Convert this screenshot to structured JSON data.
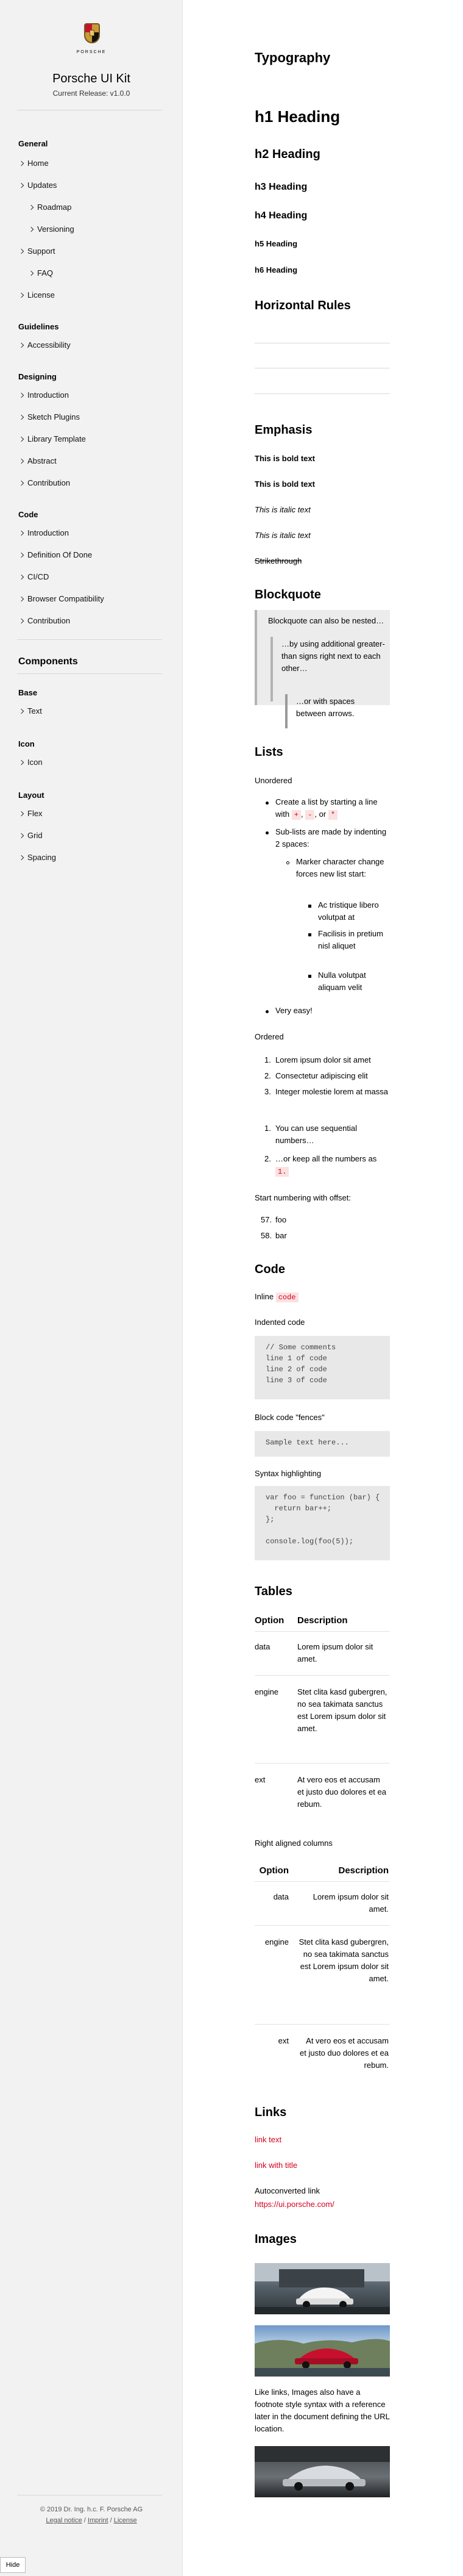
{
  "sidebar": {
    "brand": "PORSCHE",
    "title": "Porsche UI Kit",
    "release": "Current Release: v1.0.0",
    "general": {
      "label": "General",
      "items": [
        "Home",
        "Updates",
        "Roadmap",
        "Versioning",
        "Support",
        "FAQ",
        "License"
      ]
    },
    "guidelines": {
      "label": "Guidelines",
      "items": [
        "Accessibility"
      ]
    },
    "designing": {
      "label": "Designing",
      "items": [
        "Introduction",
        "Sketch Plugins",
        "Library Template",
        "Abstract",
        "Contribution"
      ]
    },
    "code": {
      "label": "Code",
      "items": [
        "Introduction",
        "Definition Of Done",
        "CI/CD",
        "Browser Compatibility",
        "Contribution"
      ]
    },
    "components_title": "Components",
    "base": {
      "label": "Base",
      "items": [
        "Text"
      ]
    },
    "icon": {
      "label": "Icon",
      "items": [
        "Icon"
      ]
    },
    "layout": {
      "label": "Layout",
      "items": [
        "Flex",
        "Grid",
        "Spacing"
      ]
    },
    "footer": {
      "copyright": "© 2019 Dr. Ing. h.c. F. Porsche AG",
      "legal": "Legal notice",
      "imprint": "Imprint",
      "license": "License",
      "sep": "/"
    },
    "hide_label": "Hide"
  },
  "main": {
    "typography": "Typography",
    "h1": "h1 Heading",
    "h2": "h2 Heading",
    "h3": "h3 Heading",
    "h4": "h4 Heading",
    "h5": "h5 Heading",
    "h6": "h6 Heading",
    "horizontal_rules": "Horizontal Rules",
    "emphasis": "Emphasis",
    "bold1": "This is bold text",
    "bold2": "This is bold text",
    "italic1": "This is italic text",
    "italic2": "This is italic text",
    "strike": "Strikethrough",
    "blockquote_title": "Blockquote",
    "bq1": "Blockquote can also be nested…",
    "bq2": "…by using additional greater-than signs right next to each other…",
    "bq3": "…or with spaces between arrows.",
    "lists_title": "Lists",
    "unordered": "Unordered",
    "ul1_pre": "Create a list by starting a line with",
    "ul1_b": "list",
    "ul1_plus": "+",
    "ul1_minus": "-",
    "ul1_or": ", or",
    "ul1_star": "*",
    "ul2": "Sub-lists are made by indenting 2 spaces:",
    "ul3": "Marker character change forces new list start:",
    "ul4a": "Ac tristique libero volutpat at",
    "ul4b": "Facilisis in pretium nisl aliquet",
    "ul4c": "Nulla volutpat aliquam velit",
    "ul5": "Very easy!",
    "ordered": "Ordered",
    "ol1": "Lorem ipsum dolor sit amet",
    "ol2": "Consectetur adipiscing elit",
    "ol3": "Integer molestie lorem at massa",
    "ol4": "You can use sequential numbers…",
    "ol5_pre": "…or keep all the numbers as",
    "ol5_code": "1.",
    "offset_label": "Start numbering with offset:",
    "off1": "foo",
    "off2": "bar",
    "off1_n": "57.",
    "off2_n": "58.",
    "code_title": "Code",
    "inline_label": "Inline",
    "inline_code": "code",
    "indented_label": "Indented code",
    "indented_code": "// Some comments\nline 1 of code\nline 2 of code\nline 3 of code",
    "fences_label": "Block code \"fences\"",
    "fences_code": "Sample text here...",
    "syntax_label": "Syntax highlighting",
    "syntax_code": "var foo = function (bar) {\n  return bar++;\n};\n\nconsole.log(foo(5));",
    "tables_title": "Tables",
    "col_option": "Option",
    "col_description": "Description",
    "rows": [
      {
        "option": "data",
        "description": "Lorem ipsum dolor sit amet."
      },
      {
        "option": "engine",
        "description": "Stet clita kasd gubergren, no sea takimata sanctus est Lorem ipsum dolor sit amet."
      },
      {
        "option": "ext",
        "description": "At vero eos et accusam et justo duo dolores et ea rebum."
      }
    ],
    "right_aligned": "Right aligned columns",
    "links_title": "Links",
    "link1": "link text",
    "link2": "link with title",
    "autoconverted": "Autoconverted link",
    "autolink": "https://ui.porsche.com/",
    "images_title": "Images",
    "images_note": "Like links, Images also have a footnote style syntax with a reference later in the document defining the URL location."
  },
  "colors": {
    "accent": "#d5001c",
    "sidebar_bg": "#f2f2f2"
  }
}
